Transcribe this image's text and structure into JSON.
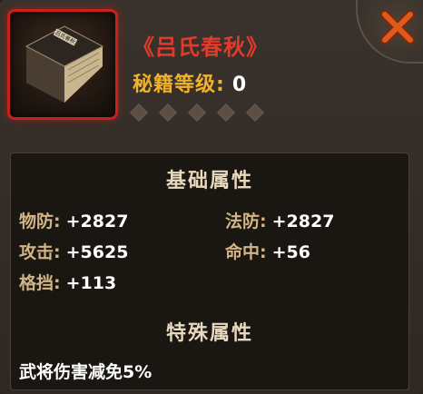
{
  "item": {
    "icon": "book-icon",
    "book_cover_text": "吕氏春秋",
    "title": "《吕氏春秋》",
    "level_label": "秘籍等级:",
    "level_value": "0",
    "stars_total": 5,
    "stars_filled": 0
  },
  "close": {
    "icon": "close-icon",
    "color": "#e05a1e"
  },
  "stats": {
    "base_title": "基础属性",
    "physical_defense": {
      "label": "物防:",
      "value": "+2827"
    },
    "magic_defense": {
      "label": "法防:",
      "value": "+2827"
    },
    "attack": {
      "label": "攻击:",
      "value": "+5625"
    },
    "hit": {
      "label": "命中:",
      "value": "+56"
    },
    "block": {
      "label": "格挡:",
      "value": "+113"
    },
    "special_title": "特殊属性",
    "special_text": "武将伤害减免5%"
  },
  "colors": {
    "title": "#e23b2a",
    "level_label": "#f0b22a",
    "stat_label": "#d2b585",
    "frame": "#c8201a"
  }
}
